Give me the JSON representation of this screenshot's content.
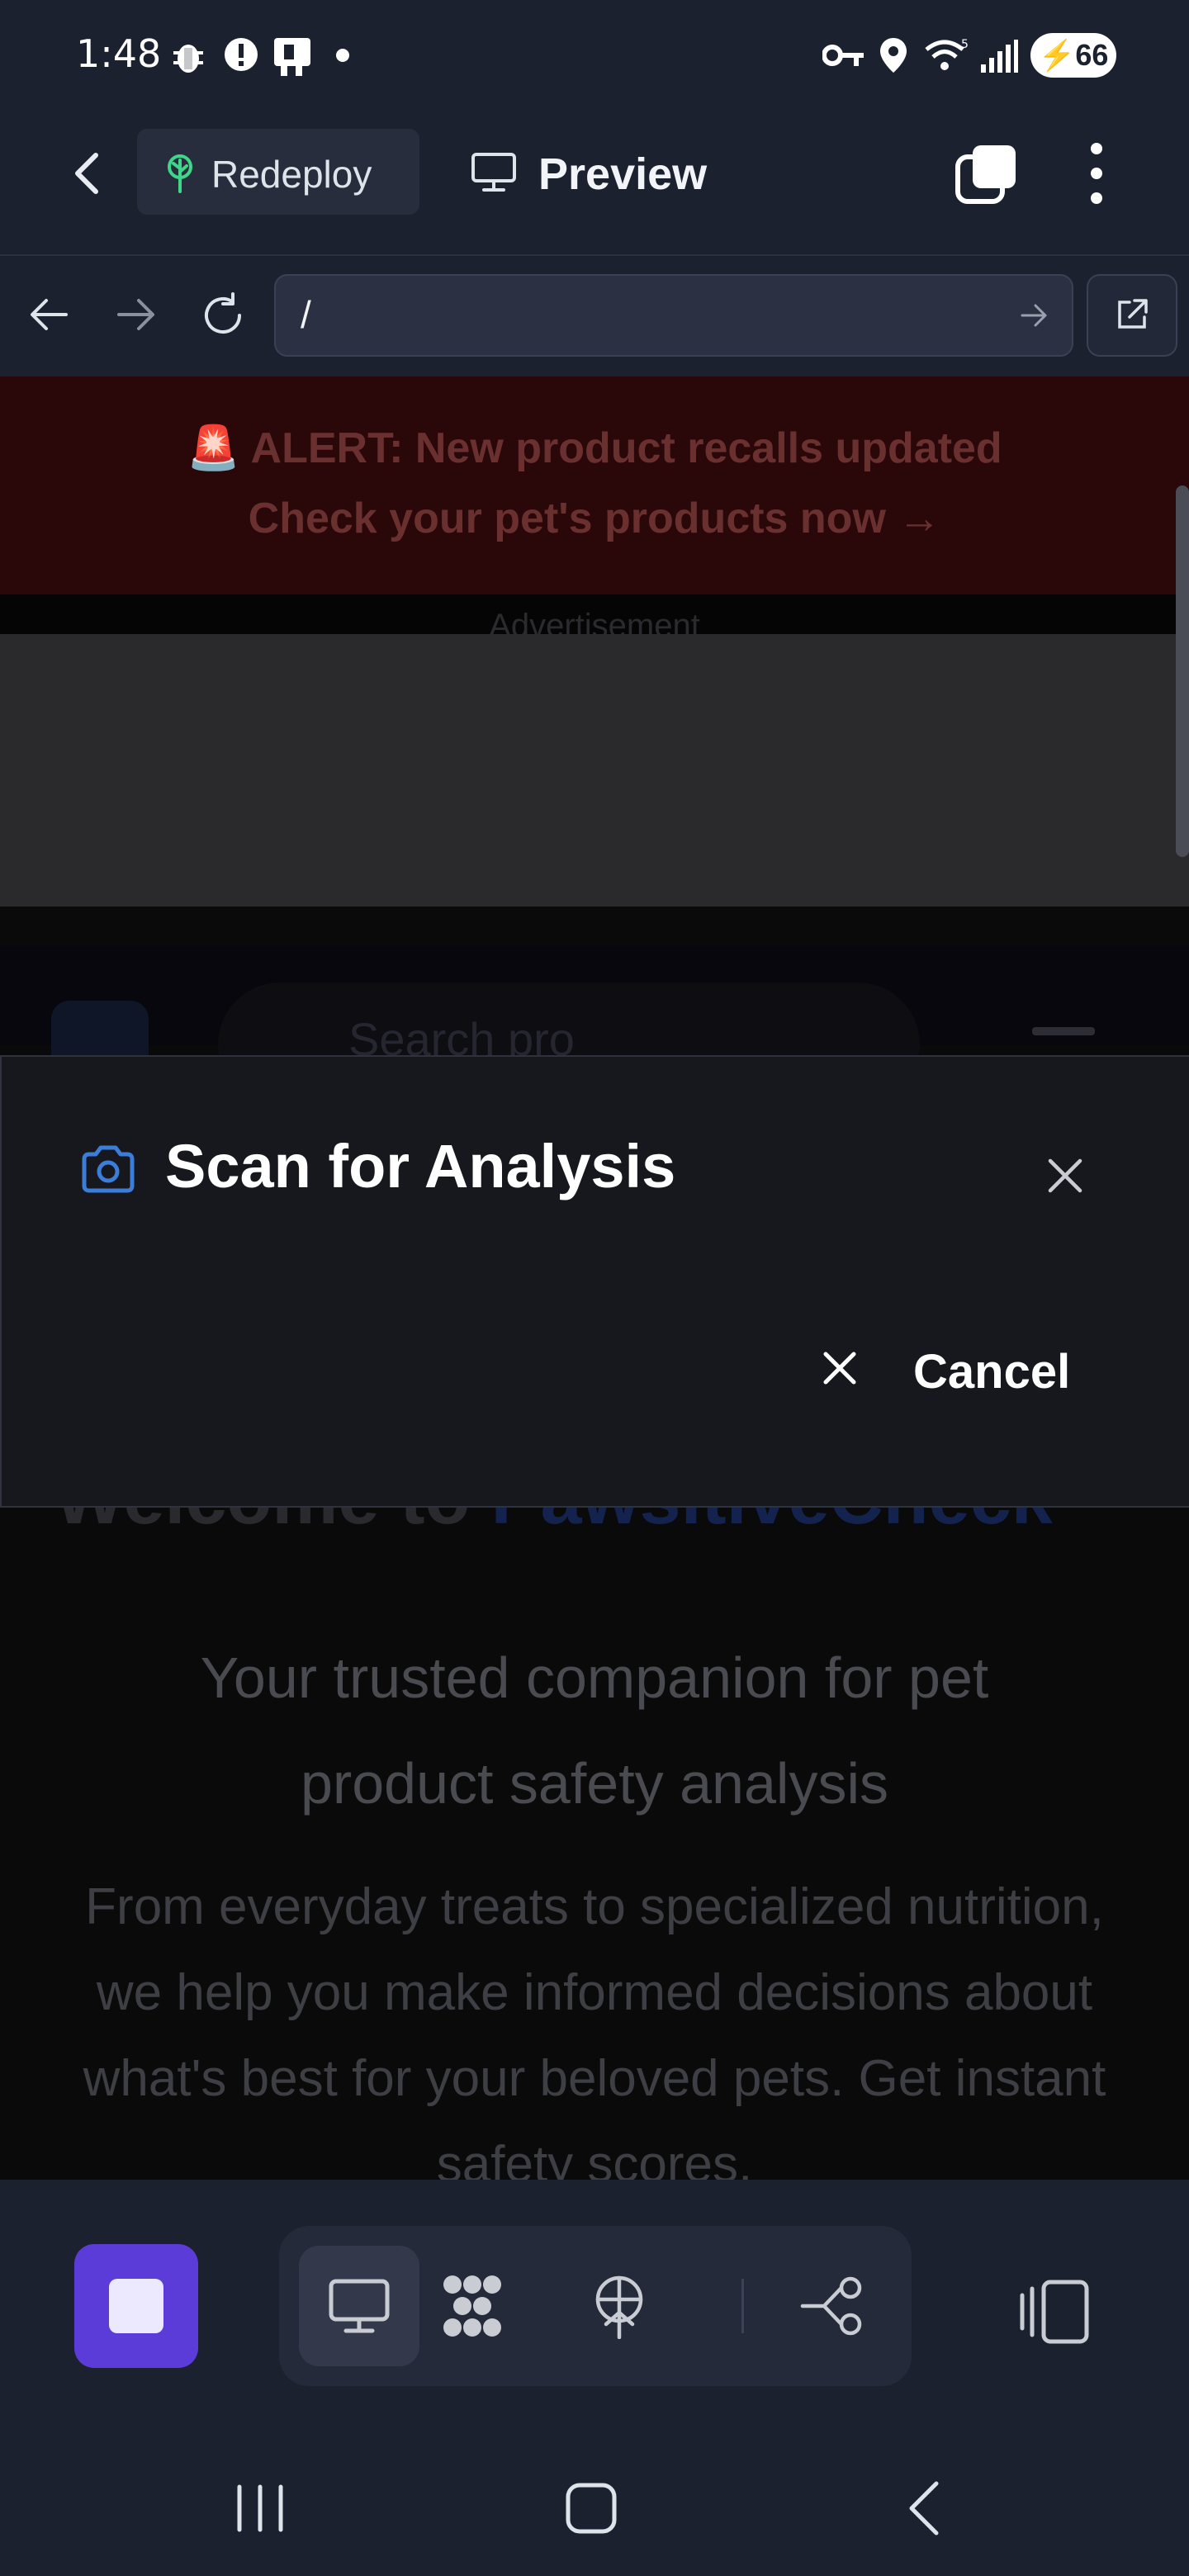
{
  "status_bar": {
    "time": "1:48",
    "battery": "66",
    "icons": [
      "bug-icon",
      "alert-icon",
      "sim-icon",
      "dot-icon",
      "key-icon",
      "location-icon",
      "wifi-icon",
      "signal-icon",
      "battery-icon"
    ]
  },
  "top_bar": {
    "back_icon": "back-arrow-icon",
    "redeploy_label": "Redeploy",
    "redeploy_icon": "deploy-tree-icon",
    "preview_label": "Preview",
    "preview_icon": "monitor-icon",
    "tabs_icon": "tabs-icon",
    "menu_icon": "more-vertical-icon"
  },
  "url_bar": {
    "url": "/",
    "icons": [
      "back-icon",
      "forward-icon",
      "reload-icon",
      "go-icon",
      "external-link-icon"
    ]
  },
  "web_content": {
    "alert_line1": "🚨 ALERT: New product recalls updated",
    "alert_line2": "Check your pet's products now →",
    "ad_placeholder": "Advertisement",
    "search_placeholder": "Search pro",
    "welcome_prefix": "Welcome to ",
    "welcome_brand": "PawsitiveCheck",
    "tagline": "Your trusted companion for pet product safety analysis",
    "description": "From everyday treats to specialized nutrition, we help you make informed decisions about what's best for your beloved pets. Get instant safety scores,"
  },
  "dialog": {
    "title": "Scan for Analysis",
    "title_icon": "camera-icon",
    "close_icon": "close-icon",
    "cancel_label": "Cancel"
  },
  "toolbar": {
    "items": [
      "stop-icon",
      "monitor-icon",
      "dots-grid-icon",
      "deploy-icon",
      "connections-icon",
      "side-panel-icon"
    ]
  },
  "nav_bar": {
    "items": [
      "recents-icon",
      "home-icon",
      "back-icon"
    ]
  },
  "colors": {
    "accent": "#5b3cd8",
    "dialog_accent": "#3b7dd8",
    "alert_bg": "#2a0708"
  }
}
